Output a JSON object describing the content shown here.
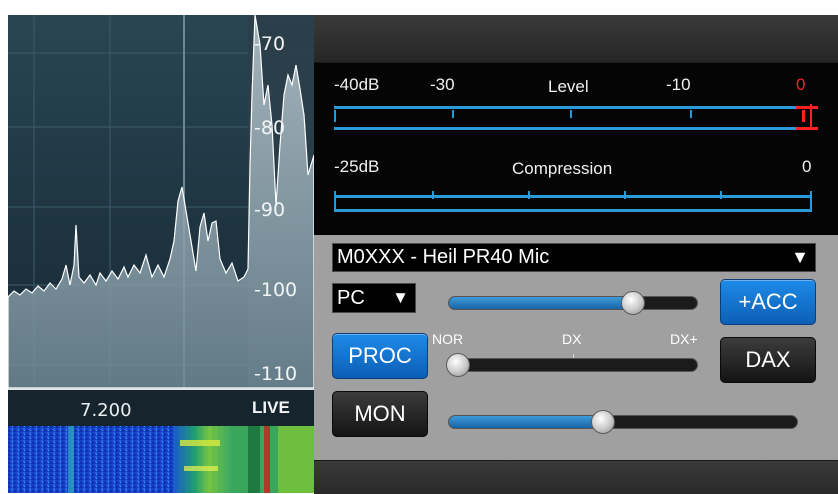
{
  "spectrum": {
    "db_scale": [
      "-70",
      "-80",
      "-90",
      "-100",
      "-110"
    ],
    "frequency": "7.200",
    "live_label": "LIVE"
  },
  "meters": {
    "level": {
      "left_label": "-40dB",
      "mid_label": "-30",
      "title": "Level",
      "right_label": "-10",
      "max_label": "0"
    },
    "compression": {
      "left_label": "-25dB",
      "title": "Compression",
      "max_label": "0"
    }
  },
  "controls": {
    "mic_profile": "M0XXX - Heil PR40 Mic",
    "dropdown_arrow": "▼",
    "mic_input": "PC",
    "acc_button": "+ACC",
    "proc_button": "PROC",
    "dax_button": "DAX",
    "mon_button": "MON",
    "proc_labels": {
      "nor": "NOR",
      "dx": "DX",
      "dxplus": "DX+"
    },
    "mic_level": 0.76,
    "proc_setting": 0.0,
    "mon_level": 0.44
  },
  "colors": {
    "accent_blue": "#1a87e6",
    "meter_blue": "#2a9bd6",
    "peak_red": "#ff2020",
    "panel_gray": "#a0a0a0"
  }
}
